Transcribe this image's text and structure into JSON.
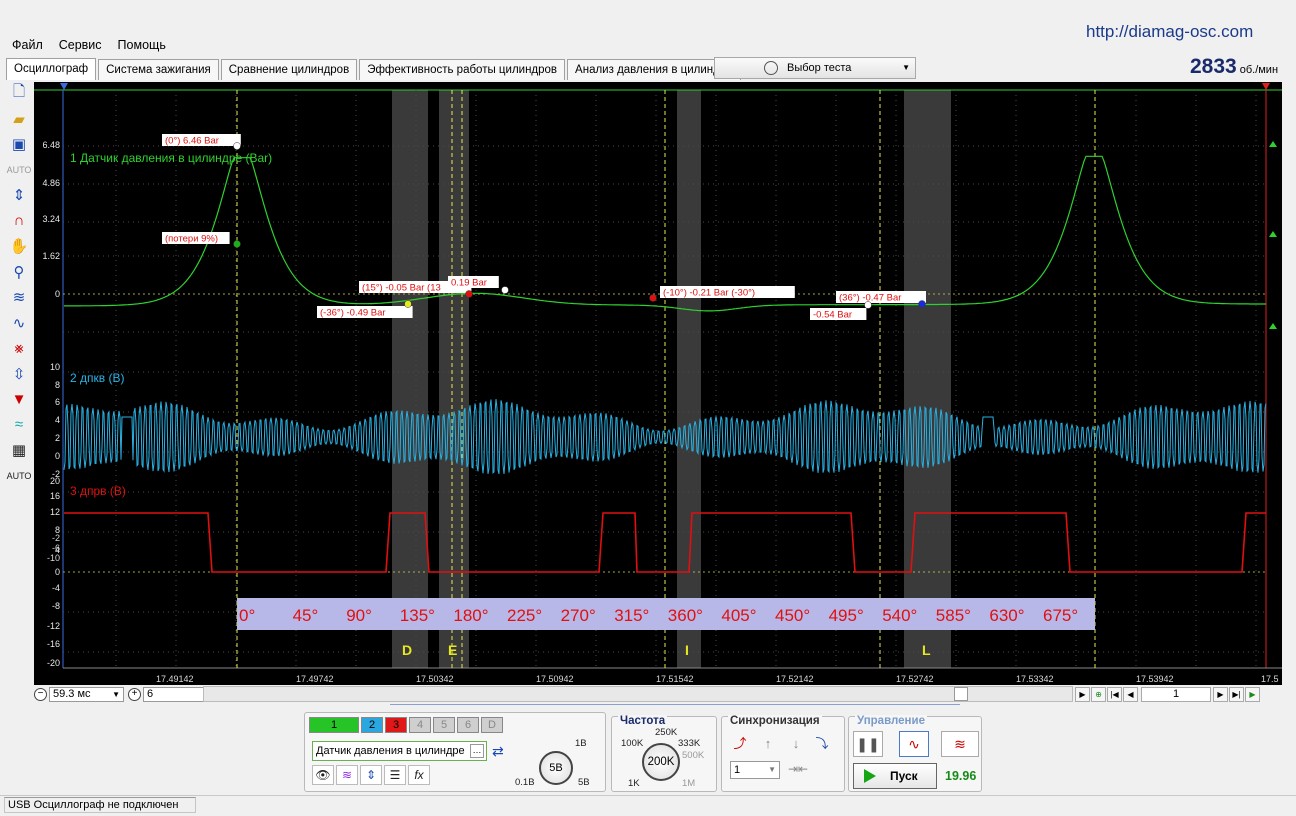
{
  "site_url": "http://diamag-osc.com",
  "menu": [
    "Файл",
    "Сервис",
    "Помощь"
  ],
  "tabs": [
    "Осциллограф",
    "Система зажигания",
    "Сравнение цилиндров",
    "Эффективность работы цилиндров",
    "Анализ давления в цилиндре"
  ],
  "test_select": "Выбор теста",
  "rpm": {
    "value": "2833",
    "unit": "об./мин"
  },
  "toolbar_icons": [
    "new-file-icon",
    "open-folder-icon",
    "save-icon",
    "auto-scale-icon",
    "vertical-cursor-icon",
    "curve-fit-icon",
    "hand-pan-icon",
    "zoom-icon",
    "wave-filter-icon",
    "phase-wave-icon",
    "trigger-icon",
    "offset-icon",
    "color-filter-icon",
    "overlay-icon",
    "table-icon",
    "auto-settings-icon"
  ],
  "channels": {
    "ch1": {
      "label": "1 Датчик давления в цилиндре (Bar)",
      "color": "#2fd12f",
      "ticks": [
        "6.48",
        "4.86",
        "3.24",
        "1.62",
        "0"
      ]
    },
    "ch2": {
      "label": "2 дпкв (В)",
      "color": "#2ab3e6",
      "ticks": [
        "10",
        "8",
        "6",
        "4",
        "2",
        "0",
        "-2"
      ]
    },
    "ch3": {
      "label": "3 дпрв (В)",
      "color": "#e01010",
      "ticks": [
        "20",
        "16",
        "12",
        "8",
        "4",
        "0",
        "-4",
        "-8",
        "-12",
        "-16",
        "-20"
      ],
      "ticks_overlap": [
        "-2",
        "-6",
        "-10"
      ]
    }
  },
  "annotations": [
    {
      "text": "(0°) 6.46 Bar"
    },
    {
      "text": "(потери 9%)"
    },
    {
      "text": "(15°) -0.05 Bar (13"
    },
    {
      "text": "0.19 Bar"
    },
    {
      "text": "(-36°) -0.49 Bar"
    },
    {
      "text": "(-10°) -0.21 Bar (-30°)"
    },
    {
      "text": "(36°) -0.47 Bar"
    },
    {
      "text": "-0.54 Bar"
    }
  ],
  "degree_scale": [
    "0°",
    "45°",
    "90°",
    "135°",
    "180°",
    "225°",
    "270°",
    "315°",
    "360°",
    "405°",
    "450°",
    "495°",
    "540°",
    "585°",
    "630°",
    "675°"
  ],
  "phase_letters": [
    "D",
    "E",
    "I",
    "L"
  ],
  "time_ticks": [
    "17.49142",
    "17.49742",
    "17.50342",
    "17.50942",
    "17.51542",
    "17.52142",
    "17.52742",
    "17.53342",
    "17.53942",
    "17.5"
  ],
  "zoom": {
    "time_per_div": "59.3 мс",
    "channel_scale": "6"
  },
  "nav": {
    "page": "1"
  },
  "channel_panel": {
    "buttons": [
      "1",
      "2",
      "3",
      "4",
      "5",
      "6",
      "D"
    ],
    "selected_channel": "Датчик давления в цилиндре",
    "voltage_knob": {
      "value": "5В",
      "labels": [
        "1В",
        "0.1В",
        "5В"
      ]
    }
  },
  "frequency": {
    "title": "Частота",
    "knob_value": "200K",
    "labels": [
      "250K",
      "100K",
      "333K",
      "500K",
      "1K",
      "1M"
    ]
  },
  "sync": {
    "title": "Синхронизация",
    "select_value": "1"
  },
  "control": {
    "title": "Управление",
    "run_label": "Пуск",
    "run_value": "19.96"
  },
  "status": "USB Осциллограф не подключен"
}
